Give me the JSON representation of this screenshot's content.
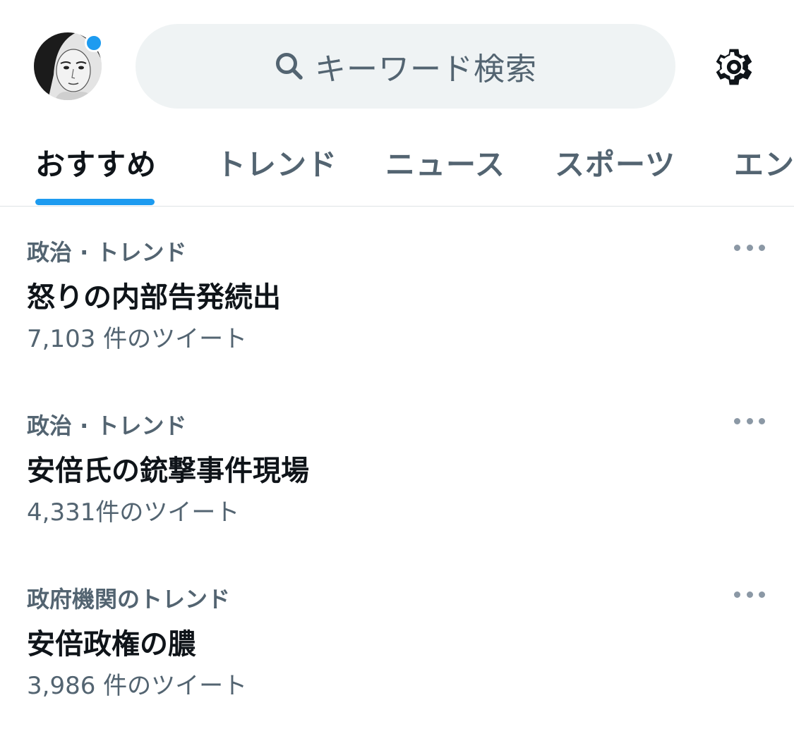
{
  "header": {
    "search_placeholder": "キーワード検索",
    "has_notification": true
  },
  "tabs": [
    {
      "label": "おすすめ",
      "active": true
    },
    {
      "label": "トレンド",
      "active": false
    },
    {
      "label": "ニュース",
      "active": false
    },
    {
      "label": "スポーツ",
      "active": false
    },
    {
      "label": "エン",
      "active": false
    }
  ],
  "trends": [
    {
      "category": "政治 · トレンド",
      "title": "怒りの内部告発続出",
      "count": "7,103 件のツイート"
    },
    {
      "category": "政治 · トレンド",
      "title": "安倍氏の銃撃事件現場",
      "count": "4,331件のツイート"
    },
    {
      "category": "政府機関のトレンド",
      "title": "安倍政権の膿",
      "count": "3,986 件のツイート"
    }
  ],
  "colors": {
    "accent": "#1d9bf0",
    "secondary_text": "#536471",
    "search_bg": "#eff3f4"
  }
}
